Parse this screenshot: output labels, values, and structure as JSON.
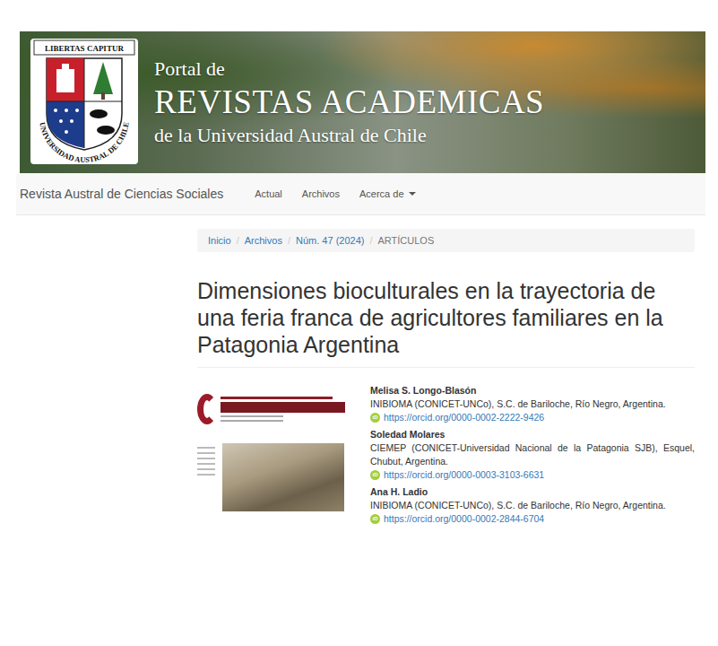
{
  "banner": {
    "motto": "LIBERTAS CAPITUR",
    "seal_text": "UNIVERSIDAD AUSTRAL DE CHILE",
    "line1": "Portal de",
    "line2": "REVISTAS ACADEMICAS",
    "line3": "de la Universidad Austral de Chile"
  },
  "navbar": {
    "brand": "Revista Austral de Ciencias Sociales",
    "items": [
      {
        "label": "Actual",
        "dropdown": false
      },
      {
        "label": "Archivos",
        "dropdown": false
      },
      {
        "label": "Acerca de",
        "dropdown": true
      }
    ]
  },
  "breadcrumb": {
    "separator": "/",
    "items": [
      {
        "label": "Inicio",
        "link": true
      },
      {
        "label": "Archivos",
        "link": true
      },
      {
        "label": "Núm. 47 (2024)",
        "link": true
      },
      {
        "label": "ARTÍCULOS",
        "link": false
      }
    ]
  },
  "article": {
    "title": "Dimensiones bioculturales en la trayectoria de una feria franca de agricultores familiares en la Patagonia Argentina",
    "orcid_icon": "iD",
    "authors": [
      {
        "name": "Melisa S. Longo-Blasón",
        "affiliation": "INIBIOMA (CONICET-UNCo), S.C. de Bariloche, Río Negro, Argentina.",
        "orcid": "https://orcid.org/0000-0002-2222-9426"
      },
      {
        "name": "Soledad Molares",
        "affiliation": "CIEMEP (CONICET-Universidad Nacional de la Patagonia SJB), Esquel, Chubut, Argentina.",
        "orcid": "https://orcid.org/0000-0003-3103-6631"
      },
      {
        "name": "Ana H. Ladio",
        "affiliation": "INIBIOMA (CONICET-UNCo), S.C. de Bariloche, Río Negro, Argentina.",
        "orcid": "https://orcid.org/0000-0002-2844-6704"
      }
    ]
  }
}
